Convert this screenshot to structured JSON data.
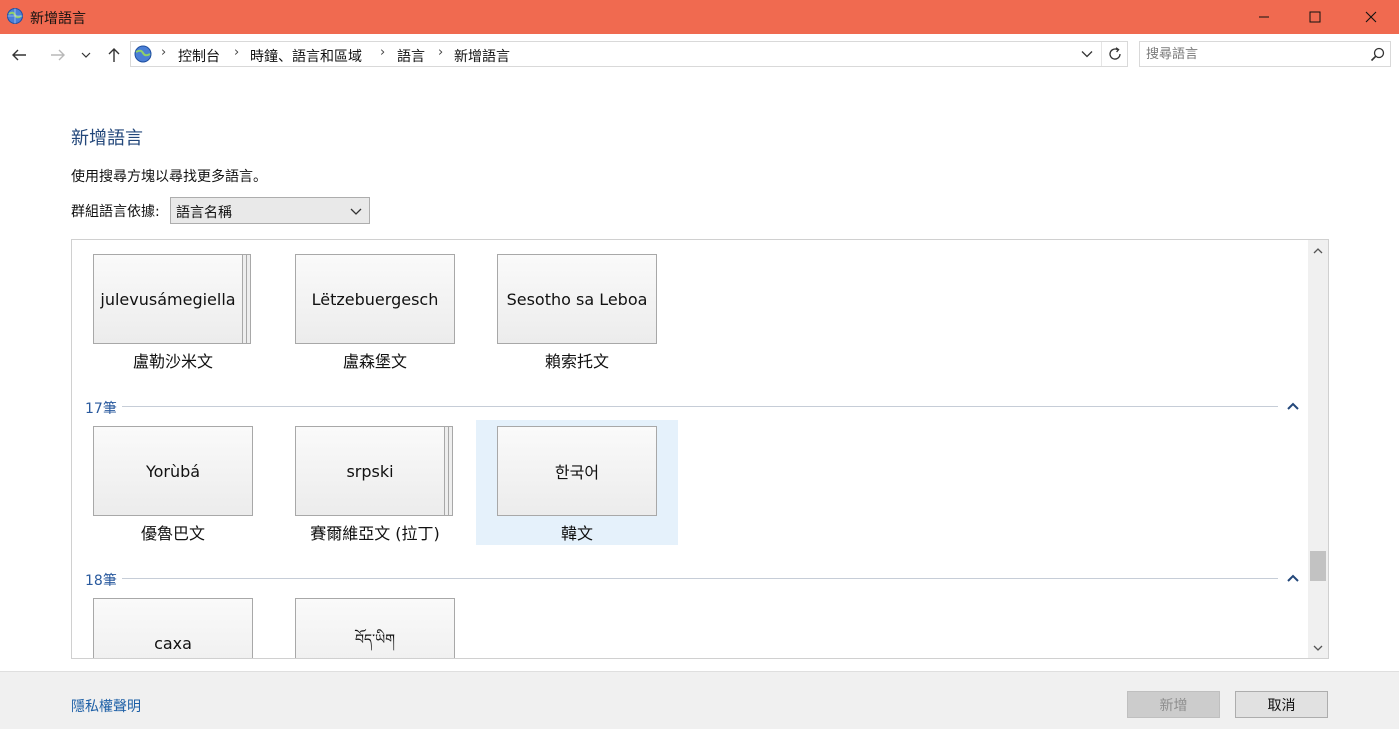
{
  "window": {
    "title": "新增語言",
    "accent_color": "#f06a50"
  },
  "nav": {
    "breadcrumbs": [
      "控制台",
      "時鐘、語言和區域",
      "語言",
      "新增語言"
    ],
    "separator": "›",
    "search_placeholder": "搜尋語言"
  },
  "page": {
    "title": "新增語言",
    "description": "使用搜尋方塊以尋找更多語言。",
    "group_by_label": "群組語言依據:",
    "group_by_value": "語言名稱"
  },
  "groups": [
    {
      "header": "",
      "tiles": [
        {
          "native": "julevusámegiella",
          "caption": "盧勒沙米文",
          "stacked": true,
          "selected": false
        },
        {
          "native": "Lëtzebuergesch",
          "caption": "盧森堡文",
          "stacked": false,
          "selected": false
        },
        {
          "native": "Sesotho sa Leboa",
          "caption": "賴索托文",
          "stacked": false,
          "selected": false
        }
      ]
    },
    {
      "header": "17筆",
      "tiles": [
        {
          "native": "Yorùbá",
          "caption": "優魯巴文",
          "stacked": false,
          "selected": false
        },
        {
          "native": "srpski",
          "caption": "賽爾維亞文 (拉丁)",
          "stacked": true,
          "selected": false
        },
        {
          "native": "한국어",
          "caption": "韓文",
          "stacked": false,
          "selected": true
        }
      ]
    },
    {
      "header": "18筆",
      "tiles": [
        {
          "native": "caxa",
          "caption": "",
          "stacked": false,
          "selected": false
        },
        {
          "native": "བོད་ཡིག",
          "caption": "",
          "stacked": false,
          "selected": false
        }
      ]
    }
  ],
  "footer": {
    "privacy_link": "隱私權聲明",
    "add_button": "新增",
    "cancel_button": "取消"
  }
}
